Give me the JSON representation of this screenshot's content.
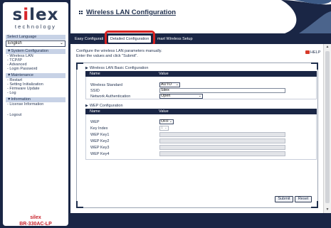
{
  "sidebar": {
    "logo_word_pre": "s",
    "logo_word_i": "i",
    "logo_word_post": "lex",
    "logo_tagline": "technology",
    "select_language_label": "Select Language",
    "language_value": "English",
    "system_configuration": {
      "heading": "▼System Configuration",
      "items": [
        "- Wireless LAN",
        "- TCP/IP",
        "- Advanced",
        "- Login Password"
      ]
    },
    "maintenance": {
      "heading": "▼Maintenance",
      "items": [
        "- Restart",
        "- Setting Initialization",
        "- Firmware Update",
        "- Log"
      ]
    },
    "information": {
      "heading": "▼Information",
      "items": [
        "- License Information"
      ]
    },
    "logout": "- Logout",
    "brand": "silex",
    "model": "BR-330AC-LP"
  },
  "header": {
    "title": "Wireless LAN Configuration"
  },
  "tabs": [
    {
      "label": "Easy Configurati"
    },
    {
      "label": "Detailed Configuration"
    },
    {
      "label": "mart Wireless Setup"
    }
  ],
  "content": {
    "instruction_line1": "Configure the wireless LAN parameters manually.",
    "instruction_line2": "Enter the values and click \"Submit\".",
    "help_label": "HELP",
    "basic_section": {
      "title": "Wireless LAN Basic Configuration",
      "col_name": "Name",
      "col_value": "Value",
      "rows": [
        {
          "label": "Wireless Standard",
          "value": "AUTO"
        },
        {
          "label": "SSID",
          "value": "Silex"
        },
        {
          "label": "Network Authentication",
          "value": "Open"
        }
      ]
    },
    "wep_section": {
      "title": "WEP Configuration",
      "col_name": "Name",
      "col_value": "Value",
      "rows": [
        {
          "label": "WEP",
          "value": "OFF"
        },
        {
          "label": "Key Index",
          "value": "1"
        },
        {
          "label": "WEP Key1",
          "value": ""
        },
        {
          "label": "WEP Key2",
          "value": ""
        },
        {
          "label": "WEP Key3",
          "value": ""
        },
        {
          "label": "WEP Key4",
          "value": ""
        }
      ]
    },
    "submit_label": "Submit",
    "reset_label": "Reset"
  },
  "colors": {
    "navy": "#1a2645",
    "accent_red": "#d62020",
    "section_header_bg": "#c7d2e6"
  },
  "icons": {
    "title_icon": "grid-icon",
    "help_icon": "help-icon",
    "section_expand": "triangle-right-icon"
  }
}
